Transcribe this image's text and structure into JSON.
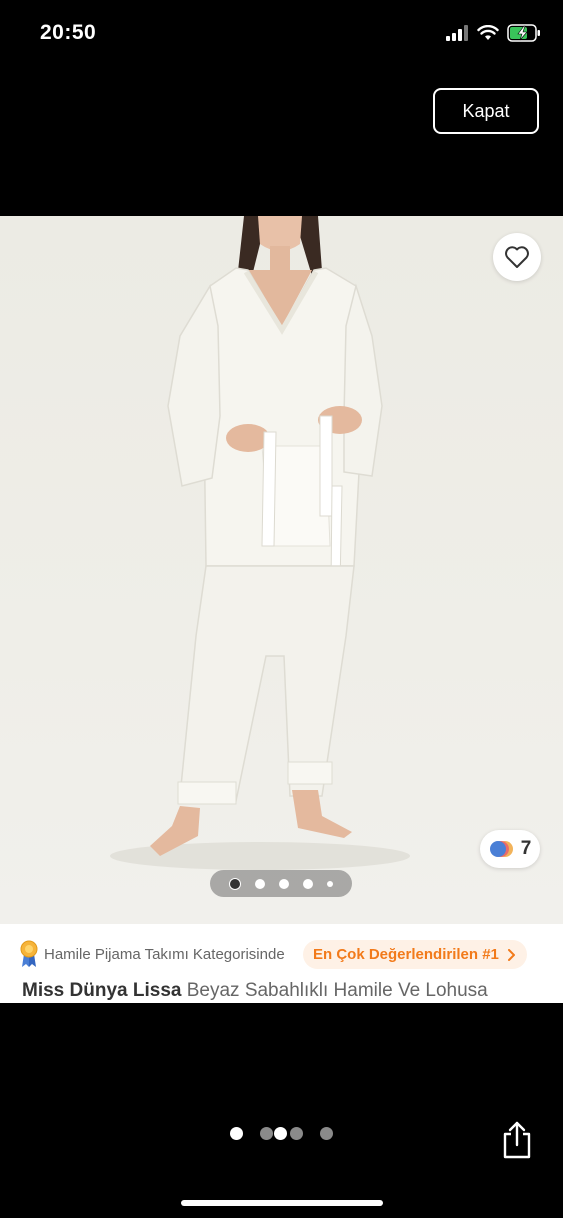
{
  "status_bar": {
    "time": "20:50"
  },
  "header": {
    "close_label": "Kapat"
  },
  "product": {
    "color_variant_count": "7",
    "image_count": 5,
    "active_image_index": 0,
    "category_text": "Hamile Pijama Takımı Kategorisinde",
    "rank_badge": "En Çok Değerlendirilen #1",
    "brand": "Miss Dünya Lissa",
    "title_rest": "Beyaz Sabahlıklı Hamile Ve Lohusa",
    "colors": {
      "accent": "#f27a1a",
      "accent_bg": "#fef1e6"
    }
  },
  "gallery": {
    "page_count": 5,
    "active_page": 1
  }
}
